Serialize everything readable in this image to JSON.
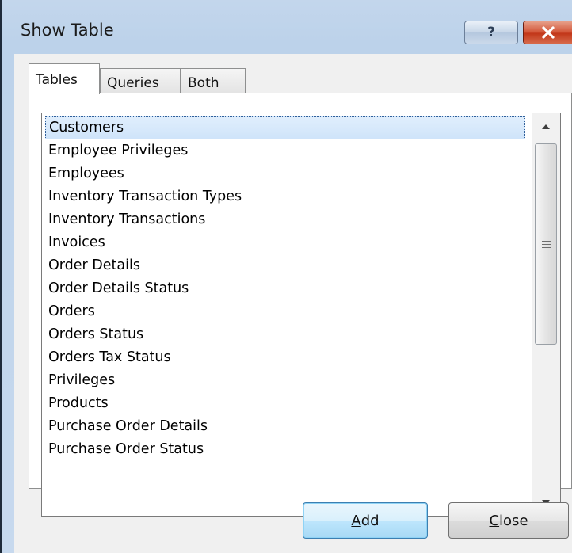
{
  "dialog": {
    "title": "Show Table",
    "help_label": "?",
    "close_icon": "close-x-icon"
  },
  "tabs": [
    {
      "label": "Tables",
      "selected": true
    },
    {
      "label": "Queries",
      "selected": false
    },
    {
      "label": "Both",
      "selected": false
    }
  ],
  "list": {
    "selected_index": 0,
    "items": [
      "Customers",
      "Employee Privileges",
      "Employees",
      "Inventory Transaction Types",
      "Inventory Transactions",
      "Invoices",
      "Order Details",
      "Order Details Status",
      "Orders",
      "Orders Status",
      "Orders Tax Status",
      "Privileges",
      "Products",
      "Purchase Order Details",
      "Purchase Order Status"
    ]
  },
  "buttons": {
    "add": {
      "accel": "A",
      "rest": "dd"
    },
    "close": {
      "accel": "C",
      "rest": "lose"
    }
  },
  "colors": {
    "titlebar": "#c3d6ec",
    "close_button": "#c2371a",
    "selection": "#cfe4fa",
    "default_button_border": "#3c7fb1"
  }
}
